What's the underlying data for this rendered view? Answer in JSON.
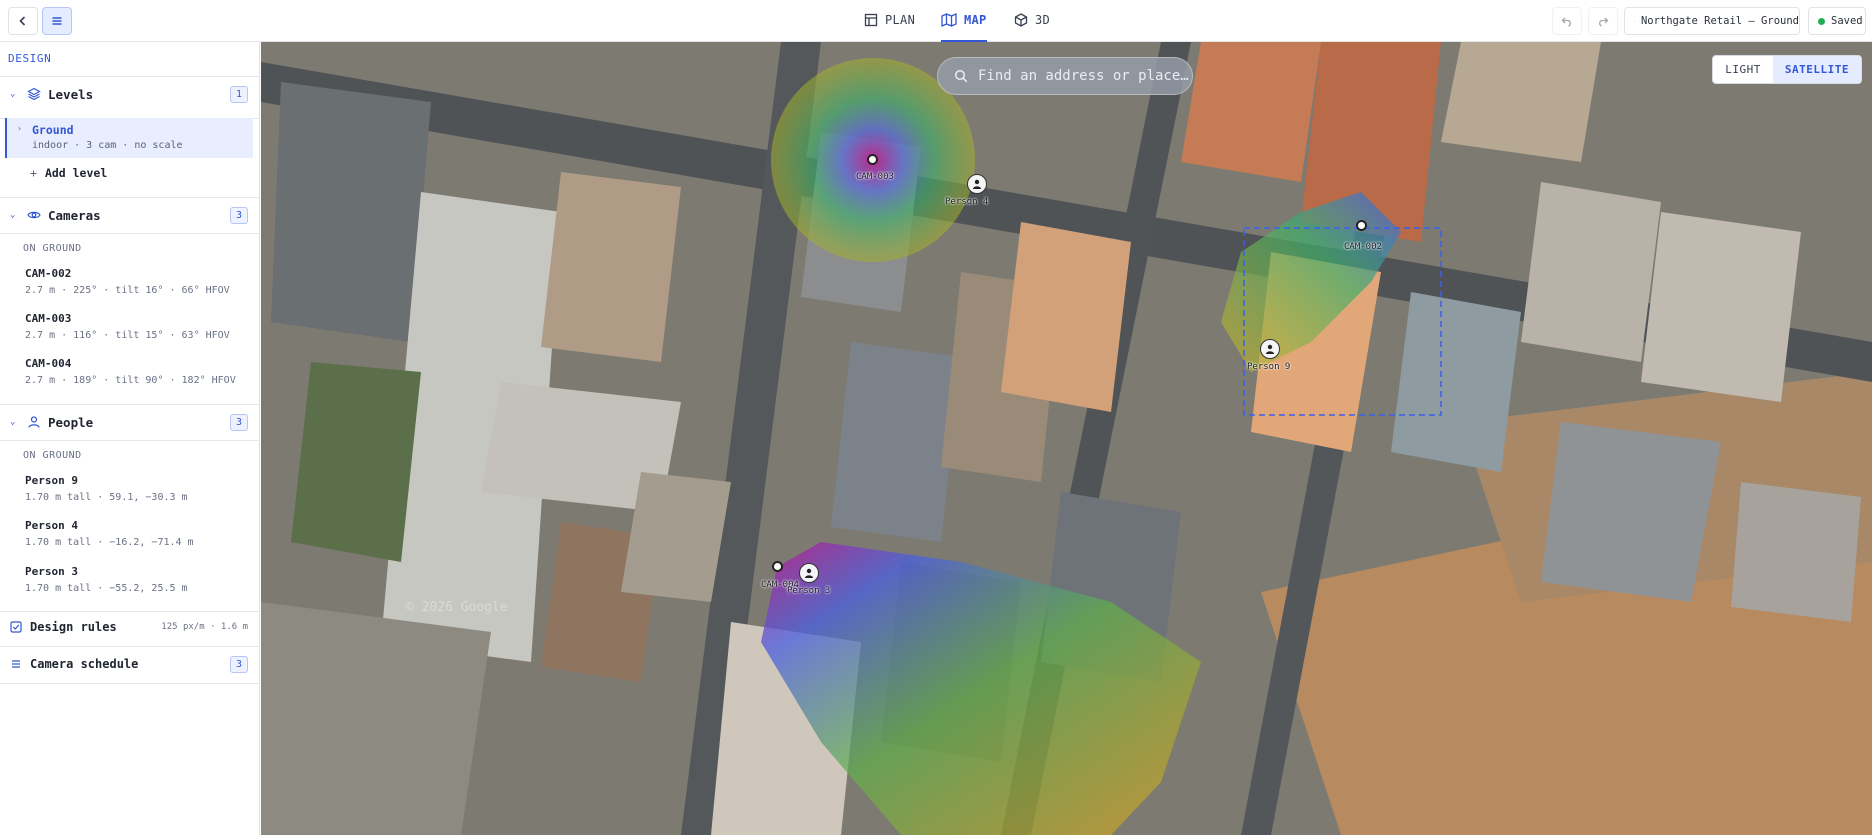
{
  "topbar": {
    "tabs": [
      {
        "label": "PLAN",
        "icon": "plan-icon",
        "active": false
      },
      {
        "label": "MAP",
        "icon": "map-icon",
        "active": true
      },
      {
        "label": "3D",
        "icon": "cube-icon",
        "active": false
      }
    ],
    "project_name": "Northgate Retail — Ground",
    "save_status": "Saved",
    "accent_color": "#3457d5",
    "status_color": "#1fae55"
  },
  "sidebar": {
    "design_label": "DESIGN",
    "levels": {
      "title": "Levels",
      "count": "1",
      "items": [
        {
          "name": "Ground",
          "meta": "indoor · 3 cam · no scale",
          "selected": true
        }
      ],
      "add_label": "Add level"
    },
    "cameras": {
      "title": "Cameras",
      "count": "3",
      "group": "ON GROUND",
      "items": [
        {
          "name": "CAM-002",
          "meta": "2.7 m · 225° · tilt 16° · 66° HFOV"
        },
        {
          "name": "CAM-003",
          "meta": "2.7 m · 116° · tilt 15° · 63° HFOV"
        },
        {
          "name": "CAM-004",
          "meta": "2.7 m · 189° · tilt 90° · 182° HFOV"
        }
      ]
    },
    "people": {
      "title": "People",
      "count": "3",
      "group": "ON GROUND",
      "items": [
        {
          "name": "Person 9",
          "meta": "1.70 m tall · 59.1, −30.3 m"
        },
        {
          "name": "Person 4",
          "meta": "1.70 m tall · −16.2, −71.4 m"
        },
        {
          "name": "Person 3",
          "meta": "1.70 m tall · −55.2, 25.5 m"
        }
      ]
    },
    "design_rules": {
      "title": "Design rules",
      "meta": "125 px/m · 1.6 m"
    },
    "camera_schedule": {
      "title": "Camera schedule",
      "count": "3"
    }
  },
  "map": {
    "search_placeholder": "Find an address or place…",
    "layer_options": [
      "LIGHT",
      "SATELLITE"
    ],
    "active_layer": "SATELLITE",
    "labels": {
      "cam_top": "CAM-003",
      "person_top": "Person 4",
      "cam_right": "CAM-002",
      "person_right": "Person 9",
      "cam_bottom": "CAM-004",
      "person_bottom": "Person 3"
    },
    "watermark": "© 2026 Google"
  }
}
